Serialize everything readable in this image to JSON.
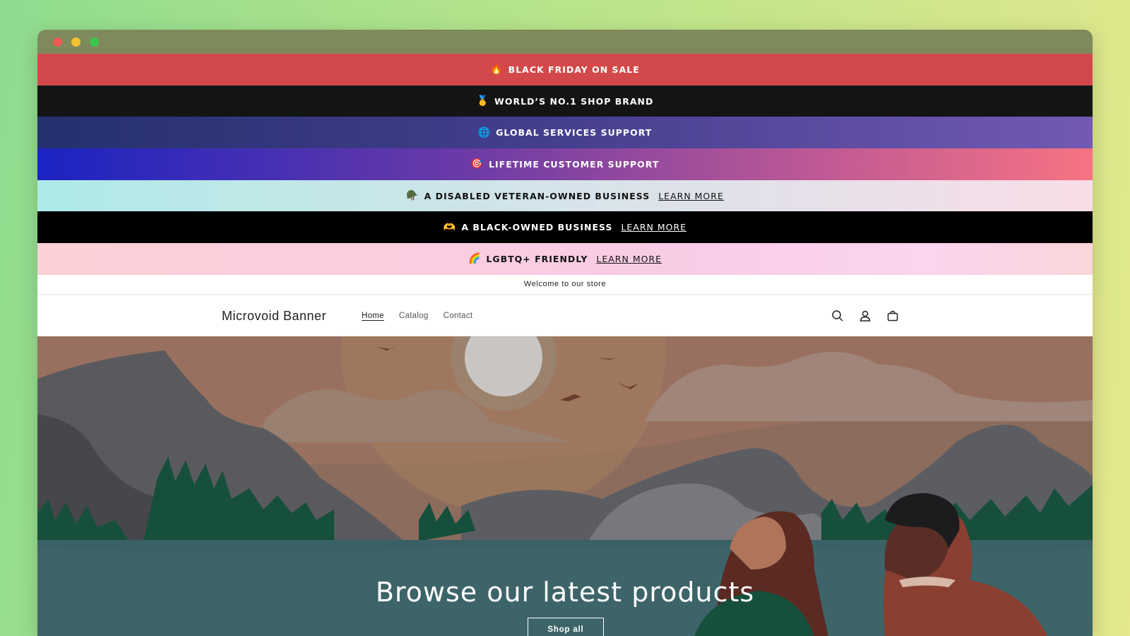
{
  "banners": [
    {
      "emoji": "🔥",
      "text": "BLACK FRIDAY ON SALE",
      "link": ""
    },
    {
      "emoji": "🥇",
      "text": "WORLD’S NO.1 SHOP BRAND",
      "link": ""
    },
    {
      "emoji": "🌐",
      "text": "GLOBAL SERVICES SUPPORT",
      "link": ""
    },
    {
      "emoji": "🎯",
      "text": "LIFETIME CUSTOMER SUPPORT",
      "link": ""
    },
    {
      "emoji": "🪖",
      "text": "A DISABLED VETERAN-OWNED BUSINESS",
      "link": "LEARN MORE"
    },
    {
      "emoji": "🫶",
      "text": "A BLACK-OWNED BUSINESS",
      "link": "LEARN MORE"
    },
    {
      "emoji": "🌈",
      "text": "LGBTQ+ FRIENDLY",
      "link": "LEARN MORE"
    }
  ],
  "announcement": "Welcome to our store",
  "header": {
    "logo": "Microvoid Banner",
    "nav": [
      "Home",
      "Catalog",
      "Contact"
    ],
    "active_nav": "Home",
    "icons": [
      "search-icon",
      "account-icon",
      "cart-icon"
    ]
  },
  "hero": {
    "title": "Browse our latest products",
    "button": "Shop all"
  }
}
